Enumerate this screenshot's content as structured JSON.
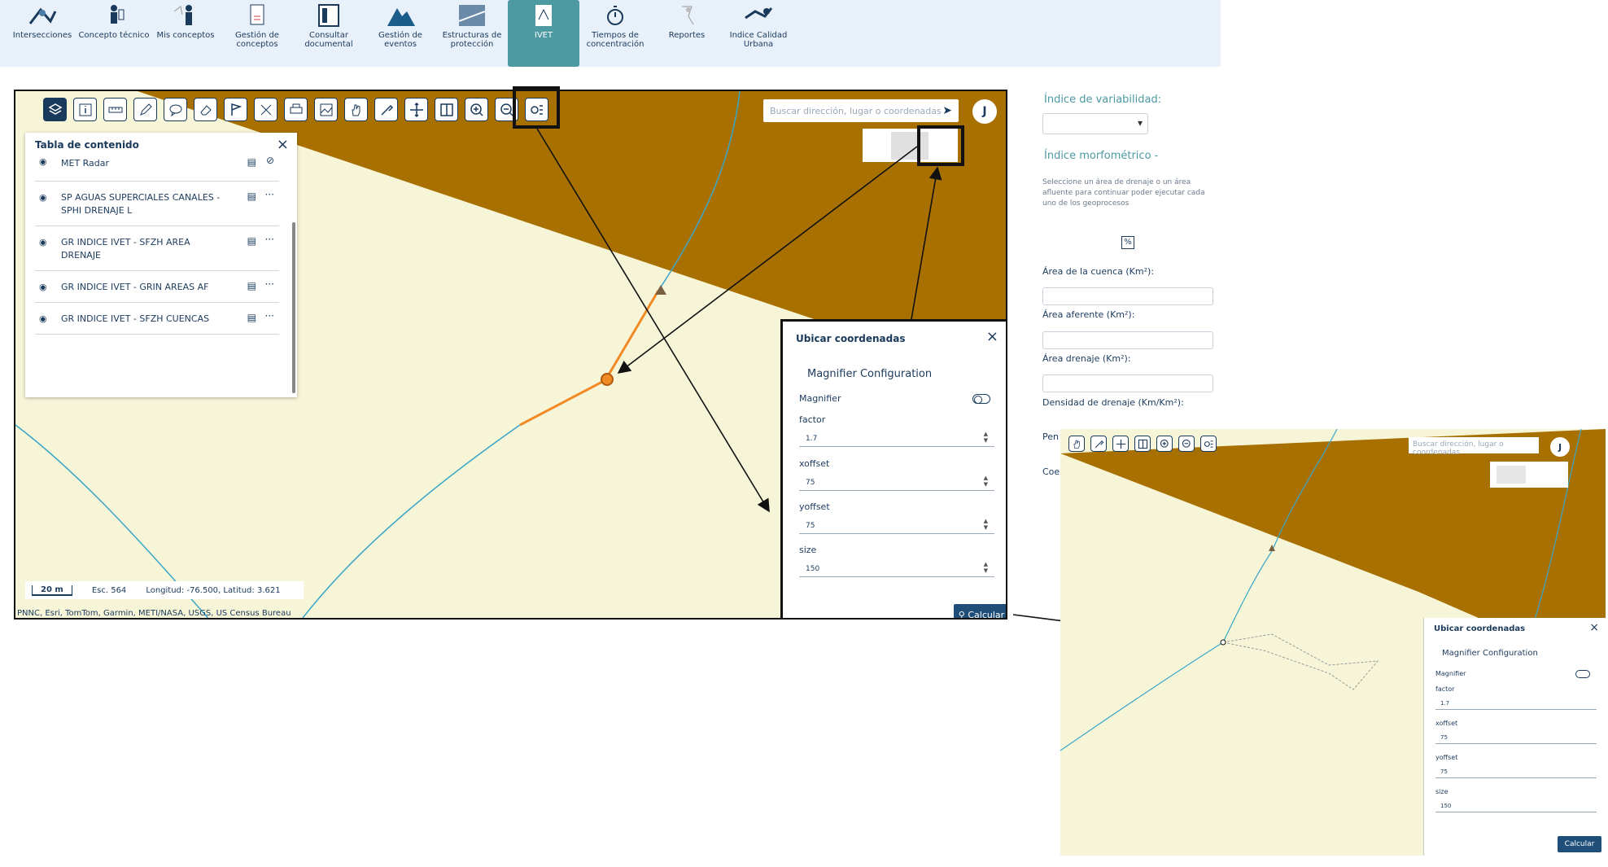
{
  "topnav": {
    "items": [
      {
        "label": "Intersecciones",
        "icon": "intersections-icon"
      },
      {
        "label": "Concepto técnico",
        "icon": "technician-icon"
      },
      {
        "label": "Mis conceptos",
        "icon": "my-concepts-icon"
      },
      {
        "label": "Gestión de conceptos",
        "icon": "document-icon"
      },
      {
        "label": "Consultar documental",
        "icon": "document-search-icon"
      },
      {
        "label": "Gestión de eventos",
        "icon": "mountain-icon"
      },
      {
        "label": "Estructuras de protección",
        "icon": "structure-icon"
      },
      {
        "label": "IVET",
        "icon": "ivet-icon",
        "active": true
      },
      {
        "label": "Tiempos de concentración",
        "icon": "stopwatch-icon"
      },
      {
        "label": "Reportes",
        "icon": "reports-icon"
      },
      {
        "label": "Indice Calidad Urbana",
        "icon": "urban-quality-icon"
      }
    ]
  },
  "map": {
    "search_placeholder": "Buscar dirección, lugar o coordenadas",
    "user_initial": "J",
    "toc": {
      "title": "Tabla de contenido",
      "layers": [
        {
          "name": "MET Radar"
        },
        {
          "name": "SP AGUAS SUPERCIALES CANALES - SPHI DRENAJE L"
        },
        {
          "name": "GR INDICE IVET - SFZH AREA DRENAJE"
        },
        {
          "name": "GR INDICE IVET - GRIN AREAS AF"
        },
        {
          "name": "GR INDICE IVET - SFZH CUENCAS"
        }
      ]
    },
    "scale": {
      "bar": "20 m",
      "esc": "Esc. 564",
      "coords": "Longitud: -76.500, Latitud: 3.621"
    },
    "attribution": "PNNC, Esri, TomTom, Garmin, METI/NASA, USGS, US Census Bureau"
  },
  "dialog": {
    "title": "Ubicar coordenadas",
    "subtitle": "Magnifier Configuration",
    "toggle_label": "Magnifier",
    "fields": [
      {
        "label": "factor",
        "value": "1.7"
      },
      {
        "label": "xoffset",
        "value": "75"
      },
      {
        "label": "yoffset",
        "value": "75"
      },
      {
        "label": "size",
        "value": "150"
      }
    ],
    "calc_label": "Calcular"
  },
  "right_panel": {
    "variability_label": "Índice de variabilidad:",
    "morph_label": "Índice morfométrico -",
    "instructions": "Seleccione un área de drenaje o un área afluente para continuar poder ejecutar cada uno de los geoprocesos",
    "fields": [
      {
        "label": "Área de la cuenca (Km²):"
      },
      {
        "label": "Área aferente (Km²):"
      },
      {
        "label": "Área drenaje (Km²):"
      },
      {
        "label": "Densidad de drenaje (Km/Km²):"
      },
      {
        "label": "Pen"
      },
      {
        "label": "Coe"
      }
    ]
  },
  "zoom": {
    "search_placeholder": "Buscar dirección, lugar o coordenadas",
    "user_initial": "J",
    "dialog_title": "Ubicar coordenadas",
    "dialog_subtitle": "Magnifier Configuration",
    "toggle_label": "Magnifier",
    "fields": [
      {
        "label": "factor",
        "value": "1.7"
      },
      {
        "label": "xoffset",
        "value": "75"
      },
      {
        "label": "yoffset",
        "value": "75"
      },
      {
        "label": "size",
        "value": "150"
      }
    ],
    "calc_label": "Calcular"
  },
  "colors": {
    "terrain": "#a87000",
    "land": "#f7f5d8",
    "river": "#3aa6c8",
    "route": "#f08a24",
    "primary": "#1f4e79",
    "accent": "#4d9aa3"
  }
}
